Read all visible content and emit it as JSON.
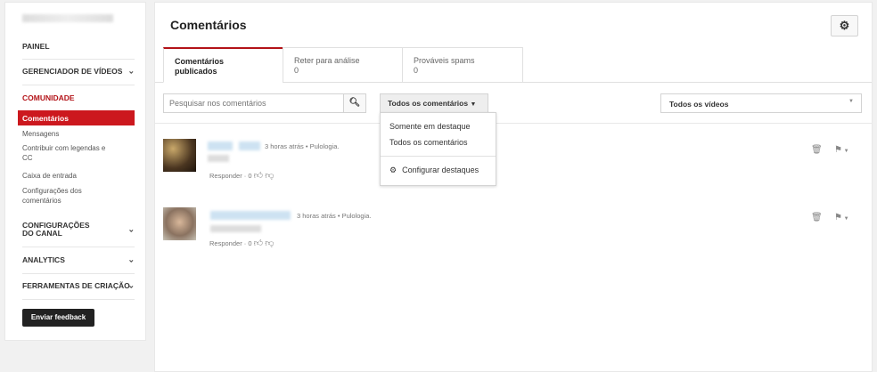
{
  "sidebar": {
    "items": [
      {
        "label": "PAINEL"
      },
      {
        "label": "GERENCIADOR DE VÍDEOS"
      },
      {
        "label": "COMUNIDADE"
      },
      {
        "label": "CONFIGURAÇÕES DO CANAL"
      },
      {
        "label": "ANALYTICS"
      },
      {
        "label": "FERRAMENTAS DE CRIAÇÃO"
      }
    ],
    "community_sub": [
      "Comentários",
      "Mensagens",
      "Contribuir com legendas e CC",
      "Caixa de entrada",
      "Configurações dos comentários"
    ],
    "feedback_button": "Enviar feedback",
    "accent": "#cc181e"
  },
  "main": {
    "title": "Comentários",
    "tabs": [
      {
        "label": "Comentários publicados",
        "count": ""
      },
      {
        "label": "Reter para análise",
        "count": "0"
      },
      {
        "label": "Prováveis spams",
        "count": "0"
      }
    ],
    "search": {
      "placeholder": "Pesquisar nos comentários"
    },
    "filter": {
      "selected": "Todos os comentários",
      "options": [
        "Somente em destaque",
        "Todos os comentários"
      ],
      "configure": "Configurar destaques"
    },
    "video_select": "Todos os vídeos",
    "comments": [
      {
        "time": "3 horas atrás",
        "video": "Pulologia.",
        "reply": "Responder",
        "likes": "0"
      },
      {
        "time": "3 horas atrás",
        "video": "Pulologia.",
        "reply": "Responder",
        "likes": "0"
      }
    ]
  }
}
